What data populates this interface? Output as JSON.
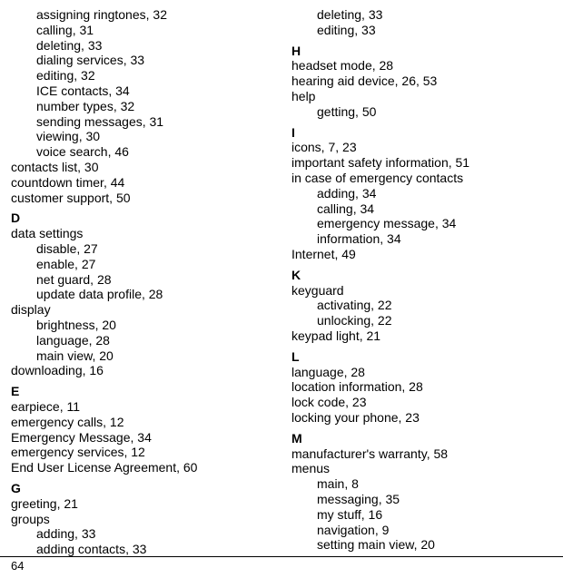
{
  "page_number": "64",
  "left_column": [
    {
      "kind": "sub",
      "label": "assigning ringtones, 32"
    },
    {
      "kind": "sub",
      "label": "calling, 31"
    },
    {
      "kind": "sub",
      "label": "deleting, 33"
    },
    {
      "kind": "sub",
      "label": "dialing services, 33"
    },
    {
      "kind": "sub",
      "label": "editing, 32"
    },
    {
      "kind": "sub",
      "label": "ICE contacts, 34"
    },
    {
      "kind": "sub",
      "label": "number types, 32"
    },
    {
      "kind": "sub",
      "label": "sending messages, 31"
    },
    {
      "kind": "sub",
      "label": "viewing, 30"
    },
    {
      "kind": "sub",
      "label": "voice search, 46"
    },
    {
      "kind": "entry",
      "label": "contacts list, 30"
    },
    {
      "kind": "entry",
      "label": "countdown timer, 44"
    },
    {
      "kind": "entry",
      "label": "customer support, 50"
    },
    {
      "kind": "letter",
      "label": "D"
    },
    {
      "kind": "heading",
      "label": "data settings"
    },
    {
      "kind": "sub",
      "label": "disable, 27"
    },
    {
      "kind": "sub",
      "label": "enable, 27"
    },
    {
      "kind": "sub",
      "label": "net guard, 28"
    },
    {
      "kind": "sub",
      "label": "update data profile, 28"
    },
    {
      "kind": "heading",
      "label": "display"
    },
    {
      "kind": "sub",
      "label": "brightness, 20"
    },
    {
      "kind": "sub",
      "label": "language, 28"
    },
    {
      "kind": "sub",
      "label": "main view, 20"
    },
    {
      "kind": "entry",
      "label": "downloading, 16"
    },
    {
      "kind": "letter",
      "label": "E"
    },
    {
      "kind": "entry",
      "label": "earpiece, 11"
    },
    {
      "kind": "entry",
      "label": "emergency calls, 12"
    },
    {
      "kind": "entry",
      "label": "Emergency Message, 34"
    },
    {
      "kind": "entry",
      "label": "emergency services, 12"
    },
    {
      "kind": "entry",
      "label": "End User License Agreement, 60"
    },
    {
      "kind": "letter",
      "label": "G"
    },
    {
      "kind": "entry",
      "label": "greeting, 21"
    },
    {
      "kind": "heading",
      "label": "groups"
    },
    {
      "kind": "sub",
      "label": "adding, 33"
    },
    {
      "kind": "sub",
      "label": "adding contacts, 33"
    }
  ],
  "right_column": [
    {
      "kind": "sub",
      "label": "deleting, 33"
    },
    {
      "kind": "sub",
      "label": "editing, 33"
    },
    {
      "kind": "letter",
      "label": "H"
    },
    {
      "kind": "entry",
      "label": "headset mode, 28"
    },
    {
      "kind": "entry",
      "label": "hearing aid device, 26, 53"
    },
    {
      "kind": "heading",
      "label": "help"
    },
    {
      "kind": "sub",
      "label": "getting, 50"
    },
    {
      "kind": "letter",
      "label": "I"
    },
    {
      "kind": "entry",
      "label": "icons, 7, 23"
    },
    {
      "kind": "entry",
      "label": "important safety information, 51"
    },
    {
      "kind": "heading",
      "label": "in case of emergency contacts"
    },
    {
      "kind": "sub",
      "label": "adding, 34"
    },
    {
      "kind": "sub",
      "label": "calling, 34"
    },
    {
      "kind": "sub",
      "label": "emergency message, 34"
    },
    {
      "kind": "sub",
      "label": "information, 34"
    },
    {
      "kind": "entry",
      "label": "Internet, 49"
    },
    {
      "kind": "letter",
      "label": "K"
    },
    {
      "kind": "heading",
      "label": "keyguard"
    },
    {
      "kind": "sub",
      "label": "activating, 22"
    },
    {
      "kind": "sub",
      "label": "unlocking, 22"
    },
    {
      "kind": "entry",
      "label": "keypad light, 21"
    },
    {
      "kind": "letter",
      "label": "L"
    },
    {
      "kind": "entry",
      "label": "language, 28"
    },
    {
      "kind": "entry",
      "label": "location information, 28"
    },
    {
      "kind": "entry",
      "label": "lock code, 23"
    },
    {
      "kind": "entry",
      "label": "locking your phone, 23"
    },
    {
      "kind": "letter",
      "label": "M"
    },
    {
      "kind": "entry",
      "label": "manufacturer's warranty, 58"
    },
    {
      "kind": "heading",
      "label": "menus"
    },
    {
      "kind": "sub",
      "label": "main, 8"
    },
    {
      "kind": "sub",
      "label": "messaging, 35"
    },
    {
      "kind": "sub",
      "label": "my stuff, 16"
    },
    {
      "kind": "sub",
      "label": "navigation, 9"
    },
    {
      "kind": "sub",
      "label": "setting main view, 20"
    }
  ]
}
